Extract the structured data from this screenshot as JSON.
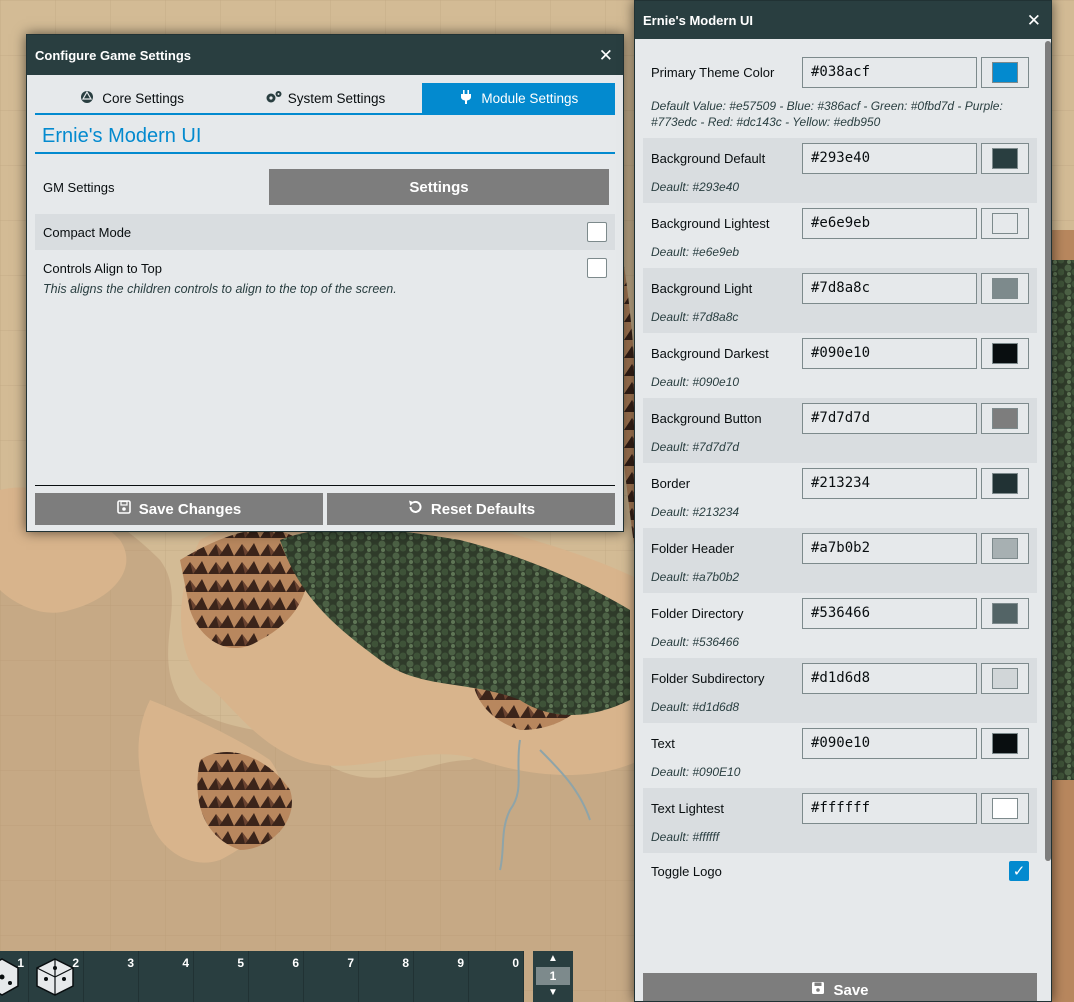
{
  "config_window": {
    "title": "Configure Game Settings",
    "tabs": [
      {
        "label": "Core Settings",
        "icon": "dice-icon"
      },
      {
        "label": "System Settings",
        "icon": "cogs-icon"
      },
      {
        "label": "Module Settings",
        "icon": "plug-icon",
        "active": true
      }
    ],
    "module_title": "Ernie's Modern UI",
    "gm_settings_label": "GM Settings",
    "settings_button": "Settings",
    "compact_mode_label": "Compact Mode",
    "controls_align_label": "Controls Align to Top",
    "controls_align_hint": "This aligns the children controls to align to the top of the screen.",
    "save_changes": "Save Changes",
    "reset_defaults": "Reset Defaults"
  },
  "ernie_panel": {
    "title": "Ernie's Modern UI",
    "settings": [
      {
        "label": "Primary Theme Color",
        "value": "#038acf",
        "hint": "Default Value: #e57509 - Blue: #386acf - Green: #0fbd7d - Purple: #773edc - Red: #dc143c - Yellow: #edb950"
      },
      {
        "label": "Background Default",
        "value": "#293e40",
        "hint": "Deault: #293e40"
      },
      {
        "label": "Background Lightest",
        "value": "#e6e9eb",
        "hint": "Deault: #e6e9eb"
      },
      {
        "label": "Background Light",
        "value": "#7d8a8c",
        "hint": "Deault: #7d8a8c"
      },
      {
        "label": "Background Darkest",
        "value": "#090e10",
        "hint": "Deault: #090e10"
      },
      {
        "label": "Background Button",
        "value": "#7d7d7d",
        "hint": "Deault: #7d7d7d"
      },
      {
        "label": "Border",
        "value": "#213234",
        "hint": "Deault: #213234"
      },
      {
        "label": "Folder Header",
        "value": "#a7b0b2",
        "hint": "Deault: #a7b0b2"
      },
      {
        "label": "Folder Directory",
        "value": "#536466",
        "hint": "Deault: #536466"
      },
      {
        "label": "Folder Subdirectory",
        "value": "#d1d6d8",
        "hint": "Deault: #d1d6d8"
      },
      {
        "label": "Text",
        "value": "#090e10",
        "hint": "Deault: #090E10"
      },
      {
        "label": "Text Lightest",
        "value": "#ffffff",
        "hint": "Deault: #ffffff"
      }
    ],
    "toggle_logo_label": "Toggle Logo",
    "save_button": "Save"
  },
  "hotbar": {
    "slots": [
      "1",
      "2",
      "3",
      "4",
      "5",
      "6",
      "7",
      "8",
      "9",
      "0"
    ],
    "page": "1"
  },
  "colors": {
    "accent": "#038acf",
    "header": "#293e40",
    "button": "#7d7d7d"
  }
}
